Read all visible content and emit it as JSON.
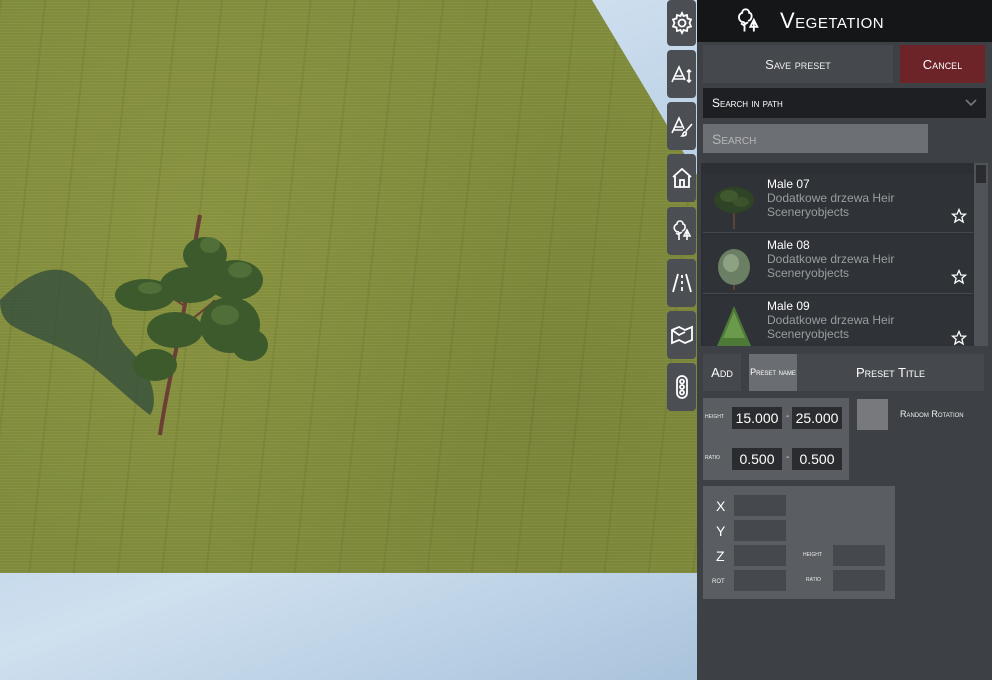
{
  "toolbar": {
    "buttons": [
      {
        "name": "settings-icon"
      },
      {
        "name": "terrain-height-icon"
      },
      {
        "name": "terrain-paint-icon"
      },
      {
        "name": "house-icon"
      },
      {
        "name": "vegetation-icon"
      },
      {
        "name": "road-icon"
      },
      {
        "name": "area-icon"
      },
      {
        "name": "traffic-light-icon"
      }
    ]
  },
  "panel": {
    "title": "Vegetation",
    "title_icon": "trees-icon",
    "save_label": "Save preset",
    "cancel_label": "Cancel",
    "path_select": "Search in path",
    "search_placeholder": "Search"
  },
  "list": {
    "items": [
      {
        "name": "Male 07",
        "path": "Dodatkowe drzewa Heir Sceneryobjects"
      },
      {
        "name": "Male 08",
        "path": "Dodatkowe drzewa Heir Sceneryobjects"
      },
      {
        "name": "Male 09",
        "path": "Dodatkowe drzewa Heir Sceneryobjects"
      }
    ]
  },
  "preset": {
    "add_label": "Add",
    "preset_name_label": "Preset name",
    "preset_title": "Preset Title"
  },
  "size": {
    "height_label": "height",
    "height_min": "15.000",
    "height_max": "25.000",
    "ratio_label": "ratio",
    "ratio_min": "0.500",
    "ratio_max": "0.500",
    "dash": "-",
    "random_rotation_label": "Random Rotation"
  },
  "transform": {
    "x_label": "X",
    "y_label": "Y",
    "z_label": "Z",
    "rot_label": "rot",
    "height_label": "height",
    "ratio_label": "ratio"
  },
  "colors": {
    "panel_bg": "#3d4146",
    "header_bg": "#151618",
    "cancel_bg": "#6c2428",
    "terrain": "#7f8a3c"
  }
}
